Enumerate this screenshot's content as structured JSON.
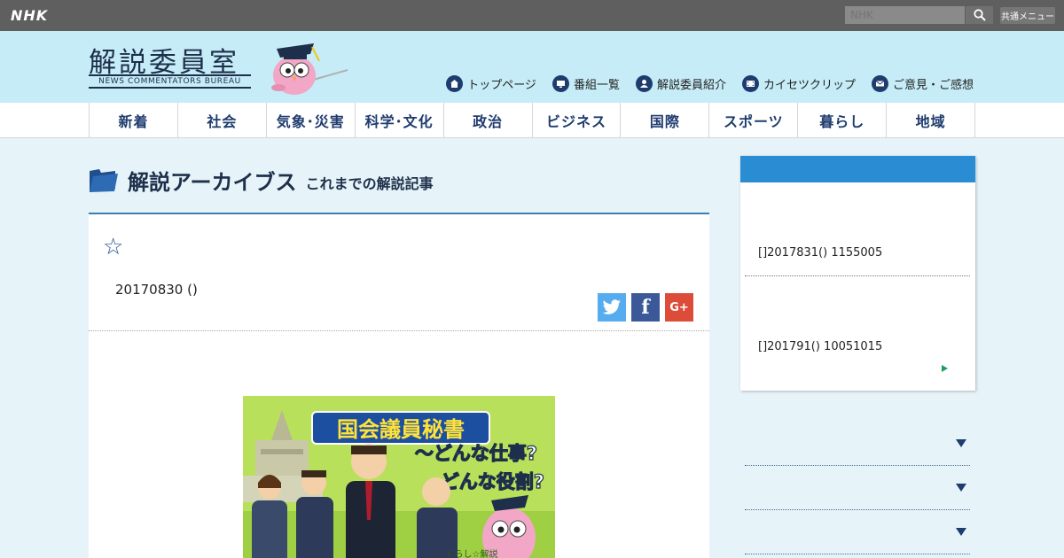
{
  "topbar": {
    "logo": "NHK",
    "search_placeholder": "NHK",
    "common_menu": "共通メニュー"
  },
  "header": {
    "title": "解説委員室",
    "subtitle": "NEWS COMMENTATORS BUREAU",
    "nav": [
      {
        "label": "トップページ",
        "icon": "home-icon"
      },
      {
        "label": "番組一覧",
        "icon": "tv-icon"
      },
      {
        "label": "解説委員紹介",
        "icon": "person-icon"
      },
      {
        "label": "カイセツクリップ",
        "icon": "film-icon"
      },
      {
        "label": "ご意見・ご感想",
        "icon": "mail-icon"
      }
    ]
  },
  "categories": [
    "新着",
    "社会",
    "気象･災害",
    "科学･文化",
    "政治",
    "ビジネス",
    "国際",
    "スポーツ",
    "暮らし",
    "地域"
  ],
  "archive": {
    "title": "解説アーカイブス",
    "subtitle": "これまでの解説記事"
  },
  "article": {
    "star": "☆",
    "date": "20170830 ()",
    "shares": {
      "twitter": "t",
      "facebook": "f",
      "google": "G+"
    },
    "hero": {
      "line1": "国会議員秘書",
      "line2": "～どんな仕事?",
      "line3": "どんな役割?",
      "watermark": "くらし☆解説"
    }
  },
  "sidebar": {
    "items": [
      "[]2017831() 1155005",
      "[]201791() 10051015"
    ]
  },
  "colors": {
    "topbar": "#5f5f5f",
    "header_bg": "#c6ecf7",
    "accent_blue": "#2a8dd4",
    "navy": "#1f3c6e"
  }
}
